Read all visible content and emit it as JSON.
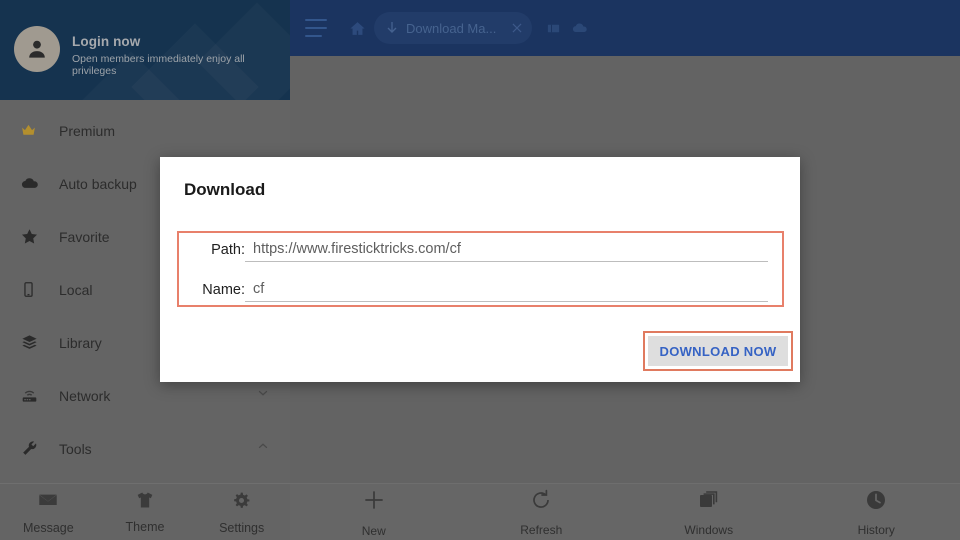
{
  "sidebar": {
    "account": {
      "title": "Login now",
      "subtitle": "Open members immediately enjoy all privileges",
      "avatar_icon": "person-icon"
    },
    "items": [
      {
        "label": "Premium",
        "icon": "crown-icon",
        "chevron": ""
      },
      {
        "label": "Auto backup",
        "icon": "cloud-icon",
        "chevron": ""
      },
      {
        "label": "Favorite",
        "icon": "star-icon",
        "chevron": ""
      },
      {
        "label": "Local",
        "icon": "phone-icon",
        "chevron": ""
      },
      {
        "label": "Library",
        "icon": "layers-icon",
        "chevron": ""
      },
      {
        "label": "Network",
        "icon": "router-icon",
        "chevron": "chevron-down-icon"
      },
      {
        "label": "Tools",
        "icon": "wrench-icon",
        "chevron": "chevron-up-icon"
      }
    ],
    "bottom_tabs": [
      {
        "label": "Message",
        "icon": "envelope-icon"
      },
      {
        "label": "Theme",
        "icon": "tshirt-icon"
      },
      {
        "label": "Settings",
        "icon": "gear-icon"
      }
    ]
  },
  "topbar": {
    "menu_icon": "hamburger-icon",
    "home_icon": "home-icon",
    "tab": {
      "icon": "download-arrow-icon",
      "title": "Download Ma...",
      "close_icon": "close-icon"
    },
    "right_icons": [
      {
        "icon": "tabs-icon"
      },
      {
        "icon": "cloud-icon"
      }
    ]
  },
  "content_bottom_tabs": [
    {
      "label": "New",
      "icon": "plus-icon"
    },
    {
      "label": "Refresh",
      "icon": "refresh-icon"
    },
    {
      "label": "Windows",
      "icon": "windows-stack-icon"
    },
    {
      "label": "History",
      "icon": "clock-icon"
    }
  ],
  "dialog": {
    "title": "Download",
    "fields": [
      {
        "label": "Path:",
        "value": "https://www.firesticktricks.com/cf",
        "placeholder": ""
      },
      {
        "label": "Name:",
        "value": "cf",
        "placeholder": ""
      }
    ],
    "primary_button": "DOWNLOAD NOW"
  },
  "colors": {
    "topbar_blue": "#1b3460",
    "sidebar_header_blue": "#1f4a72",
    "overlay_gray": "#636363",
    "highlight_red": "#e07a5f",
    "button_blue_text": "#3663c4",
    "button_bg": "#dedede"
  }
}
